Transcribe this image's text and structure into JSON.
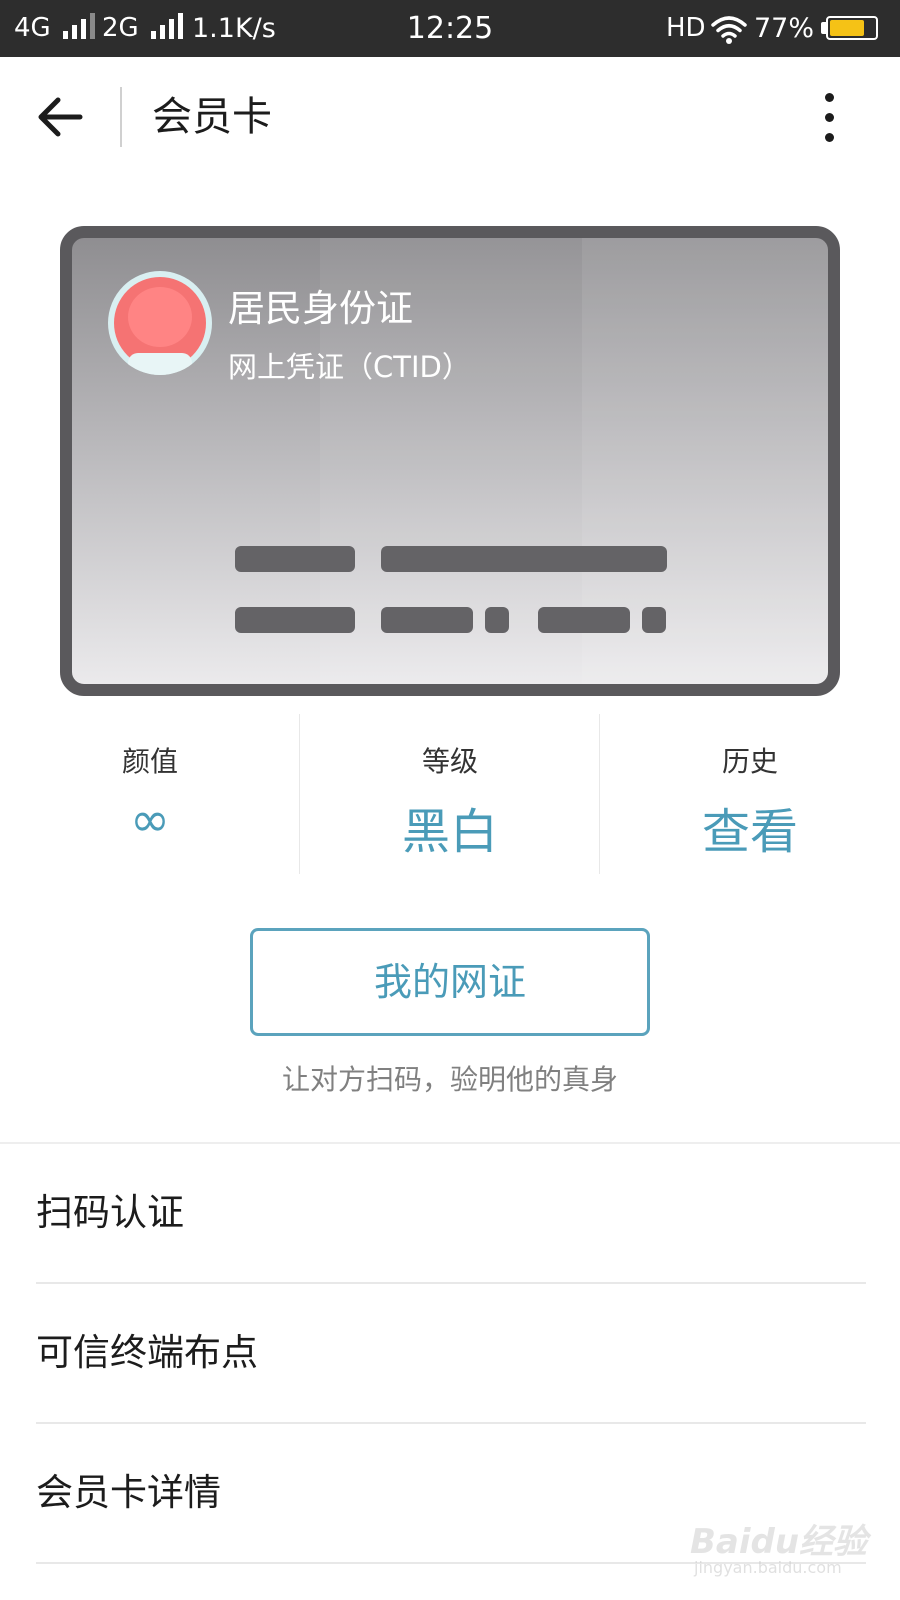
{
  "status_bar": {
    "network1": "4G",
    "network2": "2G",
    "speed": "1.1K/s",
    "time": "12:25",
    "hd": "HD",
    "battery_percent": "77%",
    "battery_level": 0.77,
    "battery_color": "#f5c216"
  },
  "header": {
    "title": "会员卡",
    "back_icon": "back-arrow-icon",
    "more_icon": "more-vertical-icon"
  },
  "card": {
    "title": "居民身份证",
    "subtitle": "网上凭证（CTID）",
    "border_color": "#5a595c"
  },
  "stats": [
    {
      "label": "颜值",
      "value": "∞"
    },
    {
      "label": "等级",
      "value": "黑白"
    },
    {
      "label": "历史",
      "value": "查看"
    }
  ],
  "accent_color": "#4a9bb8",
  "cert_button": {
    "label": "我的网证",
    "hint": "让对方扫码，验明他的真身"
  },
  "menu": [
    {
      "label": "扫码认证"
    },
    {
      "label": "可信终端布点"
    },
    {
      "label": "会员卡详情"
    }
  ],
  "watermark": {
    "text": "Baidu经验",
    "sub": "jingyan.baidu.com"
  }
}
